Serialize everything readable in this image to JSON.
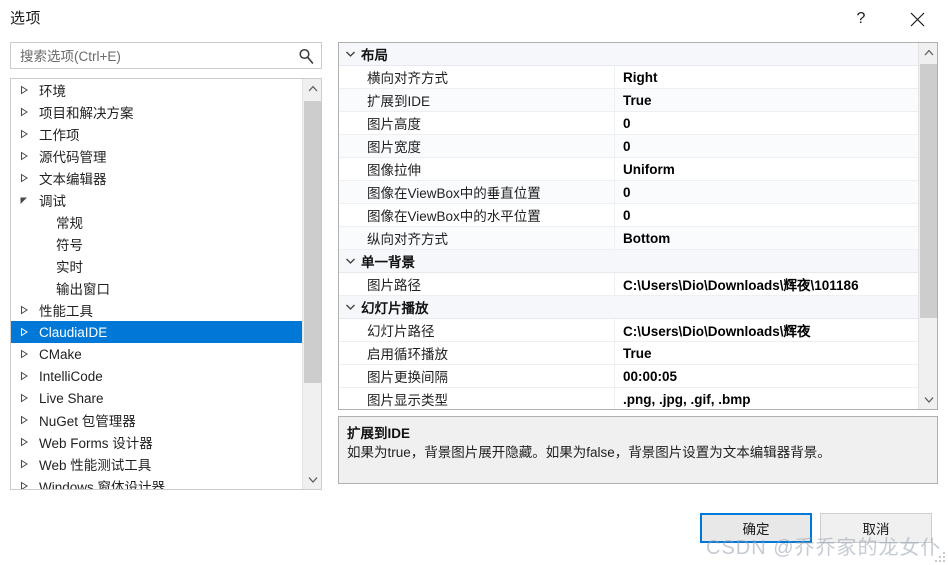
{
  "window": {
    "title": "选项",
    "help_icon": "question-mark-icon",
    "close_icon": "close-icon"
  },
  "search": {
    "placeholder": "搜索选项(Ctrl+E)",
    "value": "",
    "icon": "search-icon"
  },
  "tree": {
    "items": [
      {
        "label": "环境",
        "level": 1,
        "expandable": true,
        "expanded": false,
        "selected": false
      },
      {
        "label": "项目和解决方案",
        "level": 1,
        "expandable": true,
        "expanded": false,
        "selected": false
      },
      {
        "label": "工作项",
        "level": 1,
        "expandable": true,
        "expanded": false,
        "selected": false
      },
      {
        "label": "源代码管理",
        "level": 1,
        "expandable": true,
        "expanded": false,
        "selected": false
      },
      {
        "label": "文本编辑器",
        "level": 1,
        "expandable": true,
        "expanded": false,
        "selected": false
      },
      {
        "label": "调试",
        "level": 1,
        "expandable": true,
        "expanded": true,
        "selected": false
      },
      {
        "label": "常规",
        "level": 2,
        "expandable": false,
        "expanded": false,
        "selected": false
      },
      {
        "label": "符号",
        "level": 2,
        "expandable": false,
        "expanded": false,
        "selected": false
      },
      {
        "label": "实时",
        "level": 2,
        "expandable": false,
        "expanded": false,
        "selected": false
      },
      {
        "label": "输出窗口",
        "level": 2,
        "expandable": false,
        "expanded": false,
        "selected": false
      },
      {
        "label": "性能工具",
        "level": 1,
        "expandable": true,
        "expanded": false,
        "selected": false
      },
      {
        "label": "ClaudiaIDE",
        "level": 1,
        "expandable": true,
        "expanded": false,
        "selected": true
      },
      {
        "label": "CMake",
        "level": 1,
        "expandable": true,
        "expanded": false,
        "selected": false
      },
      {
        "label": "IntelliCode",
        "level": 1,
        "expandable": true,
        "expanded": false,
        "selected": false
      },
      {
        "label": "Live Share",
        "level": 1,
        "expandable": true,
        "expanded": false,
        "selected": false
      },
      {
        "label": "NuGet 包管理器",
        "level": 1,
        "expandable": true,
        "expanded": false,
        "selected": false
      },
      {
        "label": "Web Forms 设计器",
        "level": 1,
        "expandable": true,
        "expanded": false,
        "selected": false
      },
      {
        "label": "Web 性能测试工具",
        "level": 1,
        "expandable": true,
        "expanded": false,
        "selected": false
      },
      {
        "label": "Windows 窗体设计器",
        "level": 1,
        "expandable": true,
        "expanded": false,
        "selected": false
      }
    ],
    "scrollbar": {
      "up_icon": "chevron-up-icon",
      "down_icon": "chevron-down-icon"
    }
  },
  "property_grid": {
    "groups": [
      {
        "name": "布局",
        "expanded": true,
        "rows": [
          {
            "name": "横向对齐方式",
            "value": "Right"
          },
          {
            "name": "扩展到IDE",
            "value": "True"
          },
          {
            "name": "图片高度",
            "value": "0"
          },
          {
            "name": "图片宽度",
            "value": "0"
          },
          {
            "name": "图像拉伸",
            "value": "Uniform"
          },
          {
            "name": "图像在ViewBox中的垂直位置",
            "value": "0"
          },
          {
            "name": "图像在ViewBox中的水平位置",
            "value": "0"
          },
          {
            "name": "纵向对齐方式",
            "value": "Bottom"
          }
        ]
      },
      {
        "name": "单一背景",
        "expanded": true,
        "rows": [
          {
            "name": "图片路径",
            "value": "C:\\Users\\Dio\\Downloads\\辉夜\\101186"
          }
        ]
      },
      {
        "name": "幻灯片播放",
        "expanded": true,
        "rows": [
          {
            "name": "幻灯片路径",
            "value": "C:\\Users\\Dio\\Downloads\\辉夜"
          },
          {
            "name": "启用循环播放",
            "value": "True"
          },
          {
            "name": "图片更换间隔",
            "value": "00:00:05"
          },
          {
            "name": "图片显示类型",
            "value": ".png, .jpg, .gif, .bmp"
          }
        ]
      }
    ],
    "scrollbar": {
      "up_icon": "chevron-up-icon",
      "down_icon": "chevron-down-icon"
    }
  },
  "description": {
    "title": "扩展到IDE",
    "text": "如果为true，背景图片展开隐藏。如果为false，背景图片设置为文本编辑器背景。"
  },
  "footer": {
    "ok_label": "确定",
    "cancel_label": "取消"
  },
  "watermark": {
    "text": "CSDN @乔乔家的龙女仆"
  },
  "colors": {
    "selection": "#0078d7",
    "accent_border": "#0078d7",
    "panel_bg": "#f0f0f0",
    "category_bg": "#f5f7fa"
  }
}
